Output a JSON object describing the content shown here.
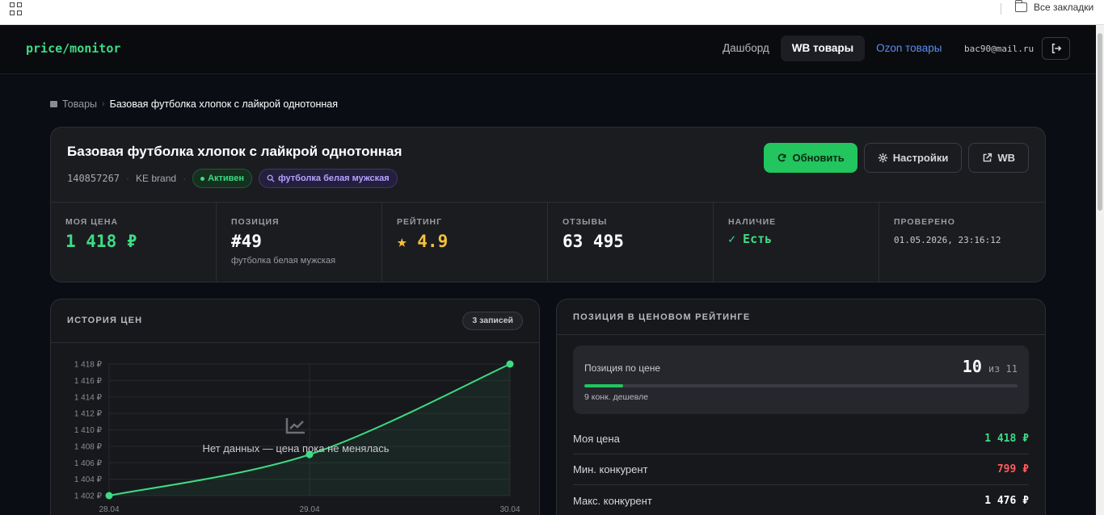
{
  "browser": {
    "all_bookmarks": "Все закладки"
  },
  "header": {
    "logo": "price/monitor",
    "nav": [
      "Дашборд",
      "WB товары",
      "Ozon товары"
    ],
    "user_email": "bac90@mail.ru"
  },
  "breadcrumb": {
    "root": "Товары",
    "current": "Базовая футболка хлопок с лайкрой однотонная"
  },
  "product": {
    "title": "Базовая футболка хлопок с лайкрой однотонная",
    "sku": "140857267",
    "brand": "KE brand",
    "status": "Активен",
    "query": "футболка белая мужская",
    "actions": {
      "refresh": "Обновить",
      "settings": "Настройки",
      "wb": "WB"
    },
    "stats": [
      {
        "label": "МОЯ ЦЕНА",
        "value": "1 418 ₽",
        "sub": ""
      },
      {
        "label": "ПОЗИЦИЯ",
        "value": "#49",
        "sub": "футболка белая мужская"
      },
      {
        "label": "РЕЙТИНГ",
        "value": "★ 4.9",
        "sub": ""
      },
      {
        "label": "ОТЗЫВЫ",
        "value": "63 495",
        "sub": ""
      },
      {
        "label": "НАЛИЧИЕ",
        "value": "✓ Есть",
        "sub": ""
      },
      {
        "label": "ПРОВЕРЕНО",
        "value": "01.05.2026, 23:16:12",
        "sub": ""
      }
    ]
  },
  "history": {
    "title": "ИСТОРИЯ ЦЕН",
    "records": "3 записей",
    "empty_text": "Нет данных — цена пока не менялась",
    "colors": {
      "line": "#3ddc84"
    }
  },
  "chart_data": {
    "type": "line",
    "x": [
      "28.04",
      "29.04",
      "30.04"
    ],
    "values": [
      1402,
      1407,
      1418
    ],
    "y_ticks": [
      1402,
      1404,
      1406,
      1408,
      1410,
      1412,
      1414,
      1416,
      1418
    ],
    "ylim": [
      1402,
      1418
    ],
    "grid": true,
    "tick_suffix": " ₽"
  },
  "rating": {
    "title": "ПОЗИЦИЯ В ЦЕНОВОМ РЕЙТИНГЕ",
    "position_label": "Позиция по цене",
    "position": "10",
    "of_total": "из 11",
    "progress_fraction": 0.09,
    "cheaper_text": "9 конк. дешевле",
    "rows": [
      {
        "label": "Моя цена",
        "value": "1 418 ₽",
        "color": "#3ddc84"
      },
      {
        "label": "Мин. конкурент",
        "value": "799 ₽",
        "color": "#ff5c5c"
      },
      {
        "label": "Макс. конкурент",
        "value": "1 476 ₽",
        "color": "#ffffff"
      }
    ]
  }
}
